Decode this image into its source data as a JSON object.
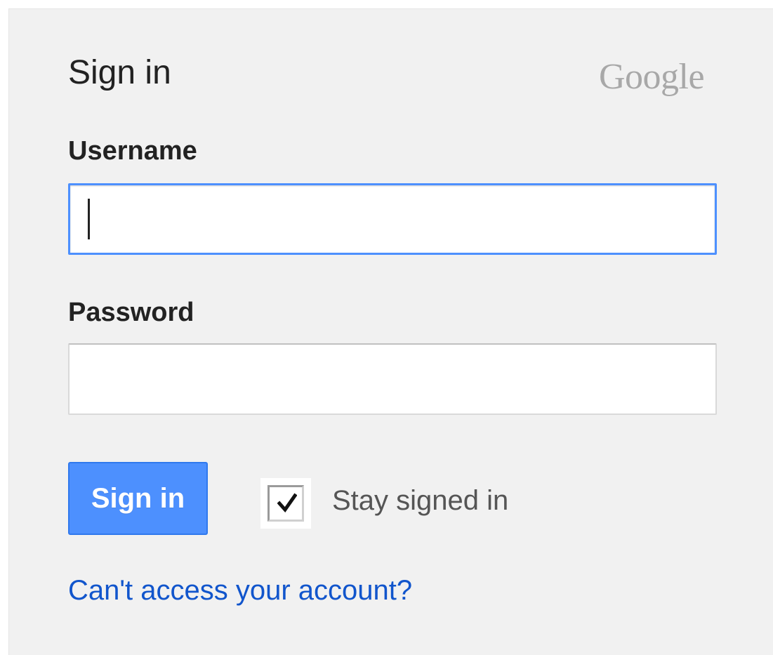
{
  "header": {
    "title": "Sign in",
    "brand": "Google"
  },
  "form": {
    "username_label": "Username",
    "username_value": "",
    "password_label": "Password",
    "password_value": "",
    "signin_label": "Sign in",
    "stay_signed_in_label": "Stay signed in",
    "stay_signed_in_checked": true,
    "help_link": "Can't access your account?"
  },
  "colors": {
    "panel_bg": "#f1f1f1",
    "primary_button": "#4d90fe",
    "focus_border": "#4d90fe",
    "link": "#1155cc",
    "brand_gray": "#a8a8a8"
  },
  "icons": {
    "checkbox": "checkmark-icon"
  }
}
